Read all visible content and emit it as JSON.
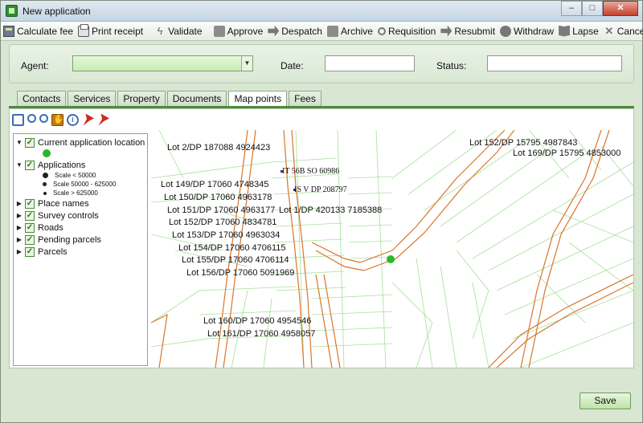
{
  "window": {
    "title": "New application",
    "minimize": "–",
    "maximize": "□",
    "close": "✕"
  },
  "toolbar": [
    {
      "id": "calculate-fee",
      "label": "Calculate fee",
      "icon": "calculator-icon"
    },
    {
      "id": "print-receipt",
      "label": "Print receipt",
      "icon": "printer-icon"
    },
    {
      "id": "validate",
      "label": "Validate",
      "icon": "lightning-icon"
    },
    {
      "id": "approve",
      "label": "Approve",
      "icon": "approve-icon"
    },
    {
      "id": "despatch",
      "label": "Despatch",
      "icon": "despatch-icon"
    },
    {
      "id": "archive",
      "label": "Archive",
      "icon": "archive-icon"
    },
    {
      "id": "requisition",
      "label": "Requisition",
      "icon": "requisition-icon"
    },
    {
      "id": "resubmit",
      "label": "Resubmit",
      "icon": "resubmit-icon"
    },
    {
      "id": "withdraw",
      "label": "Withdraw",
      "icon": "withdraw-icon"
    },
    {
      "id": "lapse",
      "label": "Lapse",
      "icon": "lapse-icon"
    },
    {
      "id": "cancel",
      "label": "Cancel",
      "icon": "cancel-icon"
    }
  ],
  "form": {
    "agent_label": "Agent:",
    "agent_value": "",
    "date_label": "Date:",
    "date_value": "",
    "status_label": "Status:",
    "status_value": ""
  },
  "tabs": [
    "Contacts",
    "Services",
    "Property",
    "Documents",
    "Map points",
    "Fees"
  ],
  "active_tab": "Map points",
  "legend": {
    "current_location": "Current application location",
    "applications": "Applications",
    "scale_items": [
      "Scale < 50000",
      "Scale 50000 - 625000",
      "Scale > 625000"
    ],
    "layers": [
      "Place names",
      "Survey controls",
      "Roads",
      "Pending parcels",
      "Parcels"
    ]
  },
  "map": {
    "parcel_labels": [
      "Lot 2/DP 187088 4924423",
      "Lot 149/DP 17060 4748345",
      "Lot 150/DP 17060 4963178",
      "Lot 151/DP 17060 4963177",
      "Lot 1/DP 420133 7185388",
      "Lot 152/DP 17060 4834781",
      "Lot 153/DP 17060 4963034",
      "Lot 154/DP 17060 4706115",
      "Lot 155/DP 17060 4706114",
      "Lot 156/DP 17060 5091969",
      "Lot 160/DP 17060 4954546",
      "Lot 161/DP 17060 4958057",
      "Lot 152/DP 15795 4987843",
      "Lot 169/DP 15795 4853000"
    ],
    "survey_labels": [
      "IT 56B SO 60986",
      "IS V DP 208797"
    ],
    "colors": {
      "roads": "#d8752a",
      "parcels": "#9fdf8f",
      "location": "#2ab72a",
      "survey": "#3a2a8a"
    }
  },
  "save_label": "Save"
}
